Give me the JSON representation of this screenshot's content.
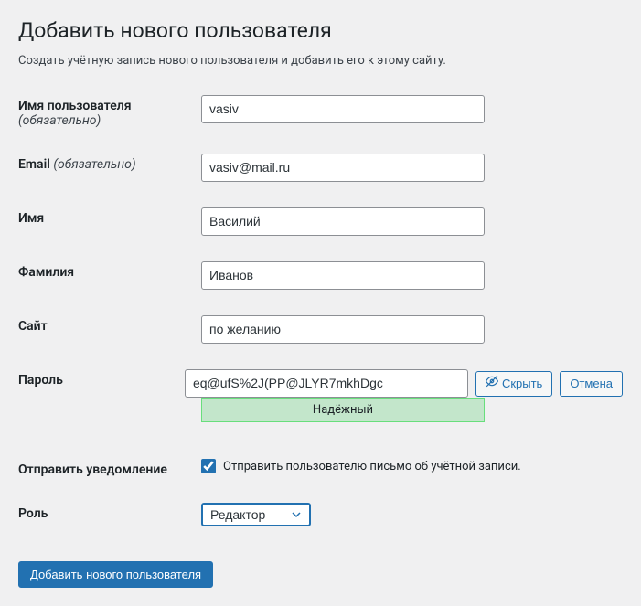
{
  "page": {
    "title": "Добавить нового пользователя",
    "description": "Создать учётную запись нового пользователя и добавить его к этому сайту."
  },
  "fields": {
    "username": {
      "label": "Имя пользователя",
      "required": "(обязательно)",
      "value": "vasiv"
    },
    "email": {
      "label": "Email",
      "required": "(обязательно)",
      "value": "vasiv@mail.ru"
    },
    "firstname": {
      "label": "Имя",
      "value": "Василий"
    },
    "lastname": {
      "label": "Фамилия",
      "value": "Иванов"
    },
    "website": {
      "label": "Сайт",
      "value": "по желанию"
    },
    "password": {
      "label": "Пароль",
      "value": "eq@ufS%2J(PP@JLYR7mkhDgc",
      "hide_button": "Скрыть",
      "cancel_button": "Отмена",
      "strength": "Надёжный"
    },
    "notification": {
      "label": "Отправить уведомление",
      "checkbox_label": "Отправить пользователю письмо об учётной записи.",
      "checked": true
    },
    "role": {
      "label": "Роль",
      "value": "Редактор",
      "options": [
        "Редактор"
      ]
    }
  },
  "submit": {
    "label": "Добавить нового пользователя"
  }
}
